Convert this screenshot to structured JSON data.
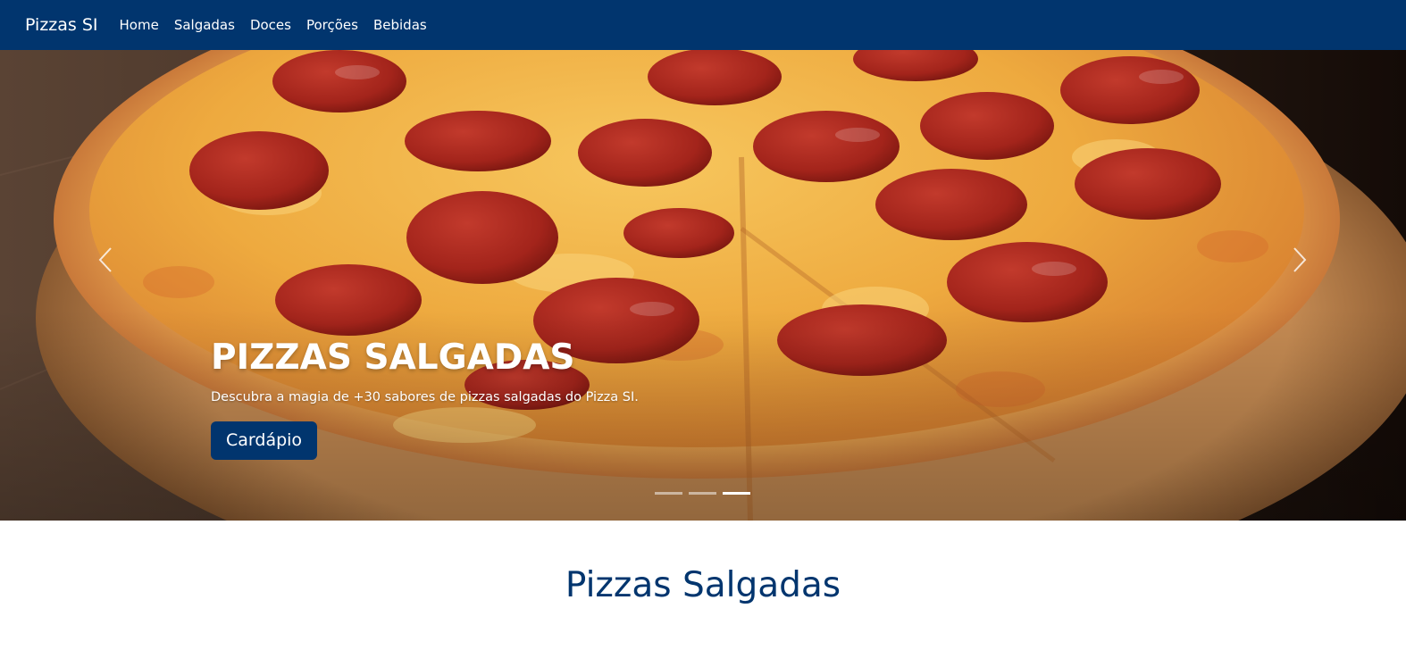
{
  "navbar": {
    "brand": "Pizzas SI",
    "links": [
      "Home",
      "Salgadas",
      "Doces",
      "Porções",
      "Bebidas"
    ],
    "background": "#01356e"
  },
  "carousel": {
    "slide_title": "PIZZAS SALGADAS",
    "slide_text": "Descubra a magia de +30 sabores de pizzas salgadas do Pizza SI.",
    "button_label": "Cardápio",
    "prev_icon": "chevron-left-icon",
    "next_icon": "chevron-right-icon",
    "indicator_count": 3,
    "active_indicator": 3
  },
  "section": {
    "title": "Pizzas Salgadas",
    "title_color": "#01356e"
  }
}
